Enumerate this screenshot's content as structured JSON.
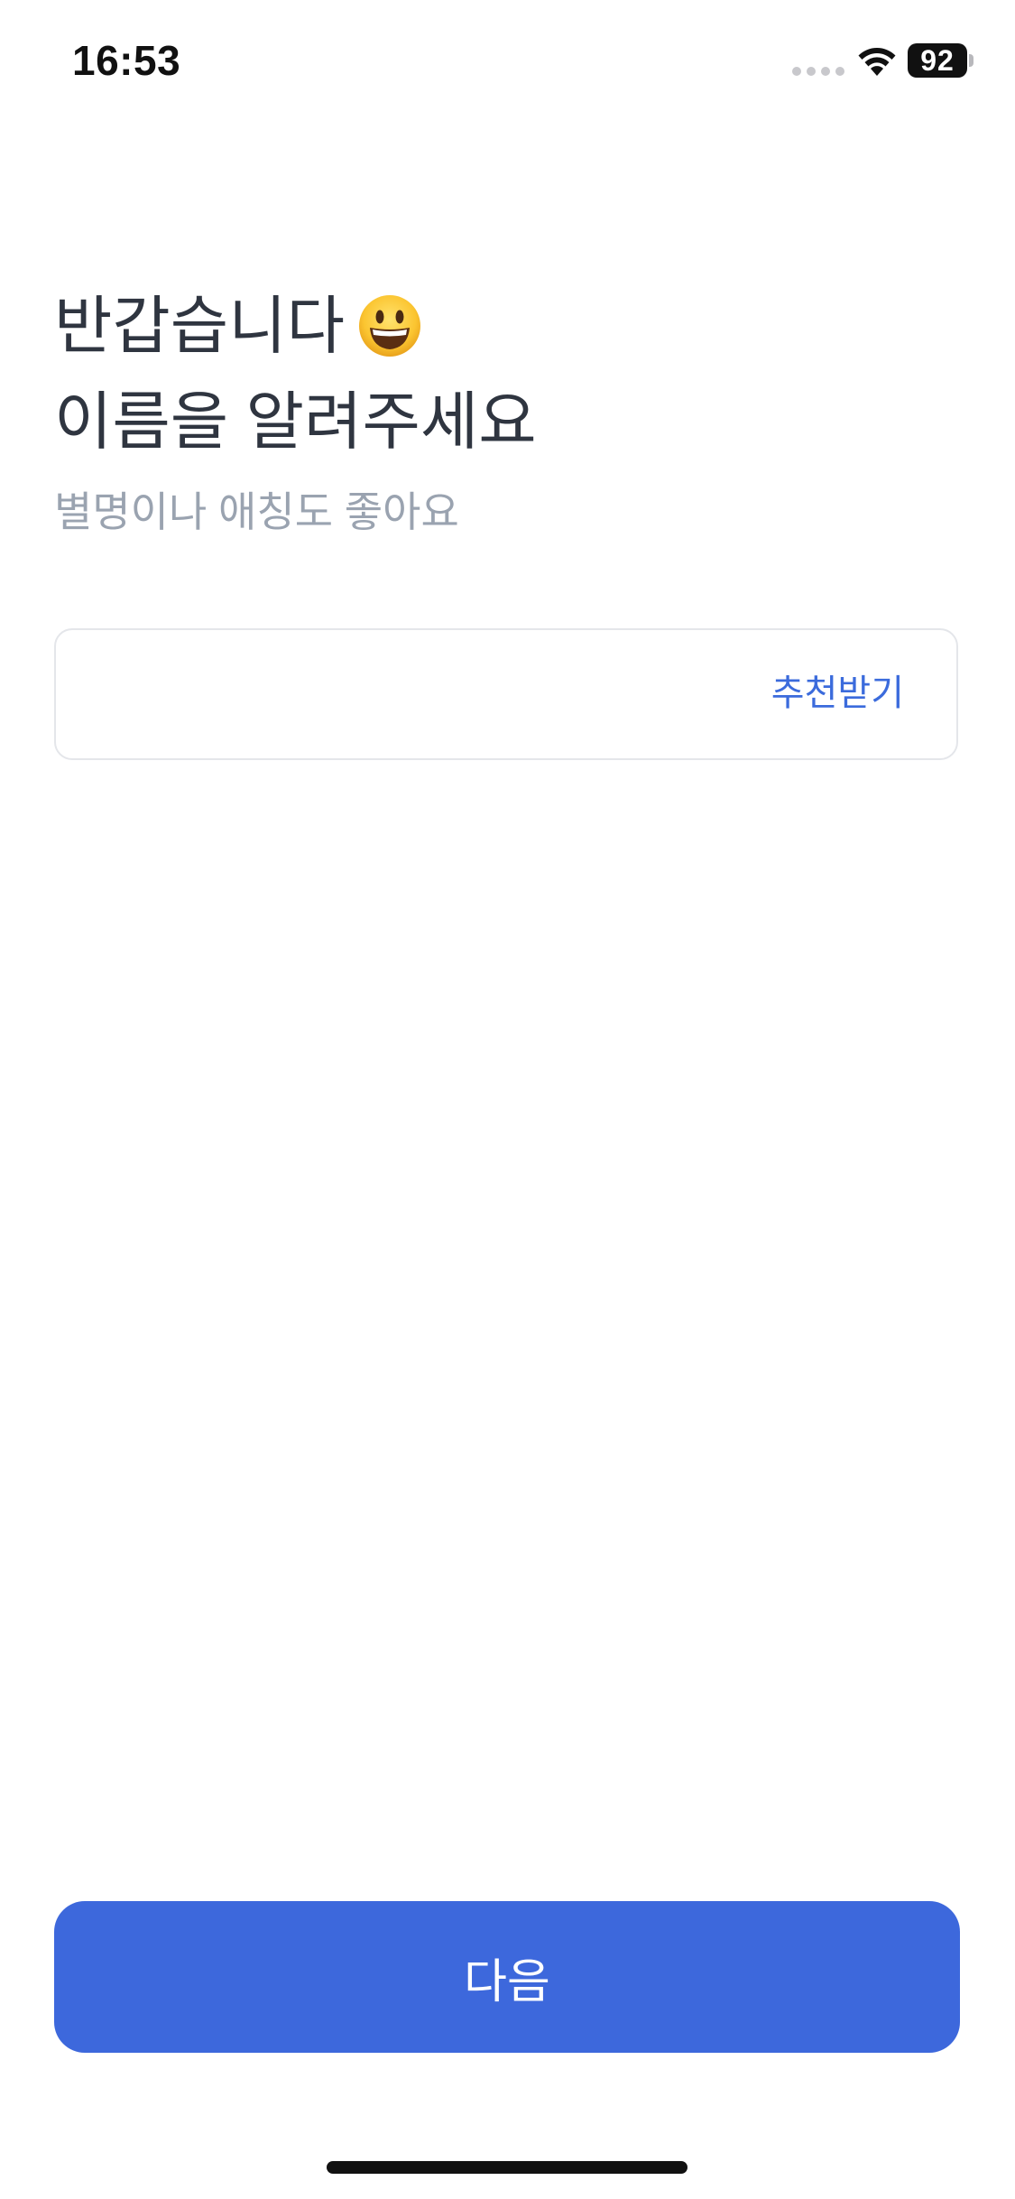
{
  "status_bar": {
    "time": "16:53",
    "battery_level": "92",
    "wifi_icon": "wifi-icon",
    "signal_icon": "cellular-signal-icon"
  },
  "header": {
    "greeting": "반갑습니다",
    "greeting_emoji_icon": "smiling-face-emoji-icon",
    "prompt": "이름을 알려주세요",
    "subtitle": "별명이나 애칭도 좋아요"
  },
  "name_input": {
    "value": "",
    "placeholder": "",
    "recommend_label": "추천받기"
  },
  "footer": {
    "next_label": "다음"
  },
  "colors": {
    "accent": "#3D68DC",
    "link": "#3B6BDC",
    "title_text": "#2F3540",
    "subtitle_text": "#9AA3B0",
    "input_border": "#E4E6EA"
  }
}
